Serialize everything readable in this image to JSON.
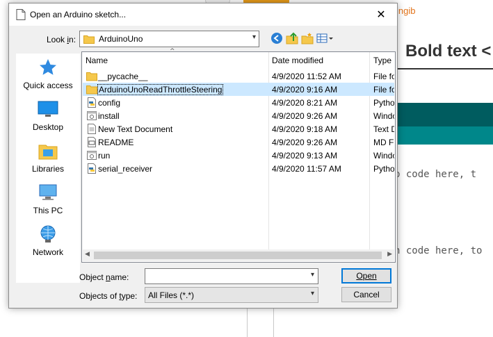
{
  "background": {
    "link_text": "ingib",
    "heading": "Bold text <",
    "code_line1": "p code here, t",
    "code_line2": "n code here, to"
  },
  "dialog": {
    "title": "Open an Arduino sketch...",
    "close_label": "✕",
    "look_in_label": "Look in:",
    "look_in_value": "ArduinoUno",
    "places": [
      {
        "label": "Quick access",
        "icon": "star-icon"
      },
      {
        "label": "Desktop",
        "icon": "desktop-icon"
      },
      {
        "label": "Libraries",
        "icon": "libraries-icon"
      },
      {
        "label": "This PC",
        "icon": "computer-icon"
      },
      {
        "label": "Network",
        "icon": "network-icon"
      }
    ],
    "columns": {
      "name": "Name",
      "date": "Date modified",
      "type": "Type"
    },
    "files": [
      {
        "name": "__pycache__",
        "date": "4/9/2020 11:52 AM",
        "type": "File fo",
        "icon": "folder-icon"
      },
      {
        "name": "ArduinoUnoReadThrottleSteering",
        "date": "4/9/2020 9:16 AM",
        "type": "File fo",
        "icon": "folder-icon"
      },
      {
        "name": "config",
        "date": "4/9/2020 8:21 AM",
        "type": "Pytho",
        "icon": "python-file-icon"
      },
      {
        "name": "install",
        "date": "4/9/2020 9:26 AM",
        "type": "Windo",
        "icon": "batch-file-icon"
      },
      {
        "name": "New Text Document",
        "date": "4/9/2020 9:18 AM",
        "type": "Text D",
        "icon": "text-file-icon"
      },
      {
        "name": "README",
        "date": "4/9/2020 9:26 AM",
        "type": "MD Fi",
        "icon": "md-file-icon"
      },
      {
        "name": "run",
        "date": "4/9/2020 9:13 AM",
        "type": "Windo",
        "icon": "batch-file-icon"
      },
      {
        "name": "serial_receiver",
        "date": "4/9/2020 11:57 AM",
        "type": "Pytho",
        "icon": "python-file-icon"
      }
    ],
    "selected_index": 1,
    "object_name_label": "Object name:",
    "object_name_value": "",
    "objects_of_type_label": "Objects of type:",
    "objects_of_type_value": "All Files (*.*)",
    "open_button": "Open",
    "cancel_button": "Cancel",
    "colors": {
      "selection": "#cce8ff",
      "default_button_border": "#0078d7",
      "folder": "#f5c84c"
    }
  }
}
